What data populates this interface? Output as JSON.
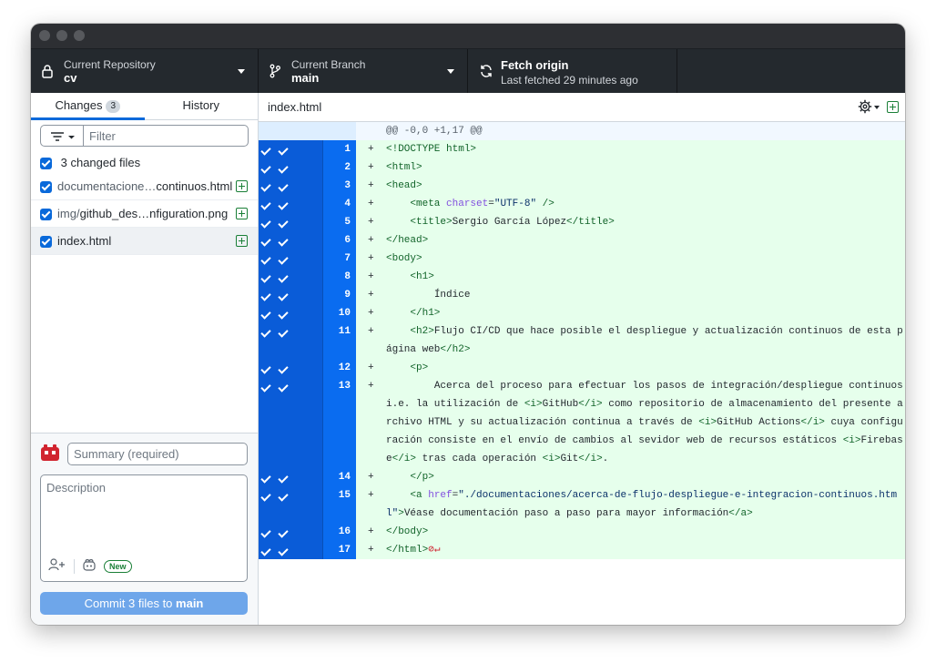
{
  "toolbar": {
    "repo": {
      "label": "Current Repository",
      "value": "cv"
    },
    "branch": {
      "label": "Current Branch",
      "value": "main"
    },
    "fetch": {
      "label": "Fetch origin",
      "value": "Last fetched 29 minutes ago"
    }
  },
  "sidebar": {
    "tabs": [
      {
        "label": "Changes",
        "badge": "3"
      },
      {
        "label": "History"
      }
    ],
    "filter_placeholder": "Filter",
    "changed_files_label": "3 changed files",
    "files": [
      {
        "path": "documentacione…",
        "name": "continuos.html"
      },
      {
        "path": "img/",
        "name": "github_des…nfiguration.png"
      },
      {
        "path": "",
        "name": "index.html"
      }
    ],
    "summary_placeholder": "Summary (required)",
    "description_placeholder": "Description",
    "new_badge": "New",
    "commit_button": {
      "prefix": "Commit 3 files to ",
      "branch": "main"
    }
  },
  "diff": {
    "file_name": "index.html",
    "hunk_header": "@@ -0,0 +1,17 @@",
    "lines": [
      {
        "n": "1",
        "parts": [
          [
            "t",
            "<!DOCTYPE html>"
          ]
        ]
      },
      {
        "n": "2",
        "parts": [
          [
            "t",
            "<html>"
          ]
        ]
      },
      {
        "n": "3",
        "parts": [
          [
            "t",
            "<head>"
          ]
        ]
      },
      {
        "n": "4",
        "parts": [
          [
            "p",
            "    "
          ],
          [
            "t",
            "<meta "
          ],
          [
            "a",
            "charset"
          ],
          [
            "p",
            "="
          ],
          [
            "v",
            "\"UTF-8\""
          ],
          [
            "t",
            " />"
          ]
        ]
      },
      {
        "n": "5",
        "parts": [
          [
            "p",
            "    "
          ],
          [
            "t",
            "<title>"
          ],
          [
            "p",
            "Sergio García López"
          ],
          [
            "t",
            "</title>"
          ]
        ]
      },
      {
        "n": "6",
        "parts": [
          [
            "t",
            "</head>"
          ]
        ]
      },
      {
        "n": "7",
        "parts": [
          [
            "t",
            "<body>"
          ]
        ]
      },
      {
        "n": "8",
        "parts": [
          [
            "p",
            "    "
          ],
          [
            "t",
            "<h1>"
          ]
        ]
      },
      {
        "n": "9",
        "parts": [
          [
            "p",
            "        Índice"
          ]
        ]
      },
      {
        "n": "10",
        "parts": [
          [
            "p",
            "    "
          ],
          [
            "t",
            "</h1>"
          ]
        ]
      },
      {
        "n": "11",
        "parts": [
          [
            "p",
            "    "
          ],
          [
            "t",
            "<h2>"
          ],
          [
            "p",
            "Flujo CI/CD que hace posible el despliegue y actualización continuos de esta página web"
          ],
          [
            "t",
            "</h2>"
          ]
        ]
      },
      {
        "n": "12",
        "parts": [
          [
            "p",
            "    "
          ],
          [
            "t",
            "<p>"
          ]
        ]
      },
      {
        "n": "13",
        "parts": [
          [
            "p",
            "        Acerca del proceso para efectuar los pasos de integración/despliegue continuos i.e. la utilización de "
          ],
          [
            "t",
            "<i>"
          ],
          [
            "p",
            "GitHub"
          ],
          [
            "t",
            "</i>"
          ],
          [
            "p",
            " como repositorio de almacenamiento del presente archivo HTML y su actualización continua a través de "
          ],
          [
            "t",
            "<i>"
          ],
          [
            "p",
            "GitHub Actions"
          ],
          [
            "t",
            "</i>"
          ],
          [
            "p",
            " cuya configuración consiste en el envío de cambios al sevidor web de recursos estáticos "
          ],
          [
            "t",
            "<i>"
          ],
          [
            "p",
            "Firebase"
          ],
          [
            "t",
            "</i>"
          ],
          [
            "p",
            " tras cada operación "
          ],
          [
            "t",
            "<i>"
          ],
          [
            "p",
            "Git"
          ],
          [
            "t",
            "</i>"
          ],
          [
            "p",
            "."
          ]
        ]
      },
      {
        "n": "14",
        "parts": [
          [
            "p",
            "    "
          ],
          [
            "t",
            "</p>"
          ]
        ]
      },
      {
        "n": "15",
        "parts": [
          [
            "p",
            "    "
          ],
          [
            "t",
            "<a "
          ],
          [
            "a",
            "href"
          ],
          [
            "p",
            "="
          ],
          [
            "v",
            "\"./documentaciones/acerca-de-flujo-despliegue-e-integracion-continuos.html\""
          ],
          [
            "t",
            ">"
          ],
          [
            "p",
            "Véase documentación paso a paso para mayor información"
          ],
          [
            "t",
            "</a>"
          ]
        ]
      },
      {
        "n": "16",
        "parts": [
          [
            "t",
            "</body>"
          ]
        ]
      },
      {
        "n": "17",
        "parts": [
          [
            "t",
            "</html>"
          ]
        ],
        "no_eol": true
      }
    ]
  }
}
